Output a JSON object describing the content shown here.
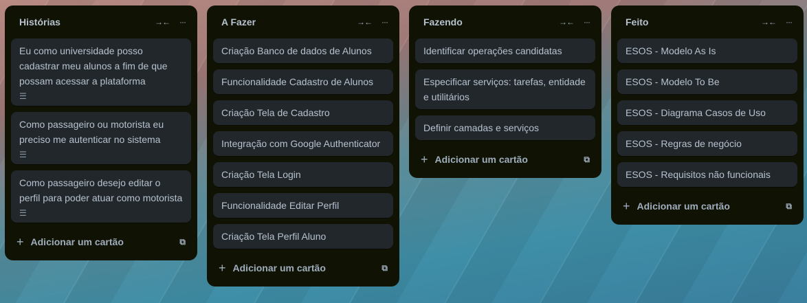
{
  "lists": [
    {
      "title": "Histórias",
      "cards": [
        {
          "text": "Eu como universidade posso cadastrar meu alunos a fim de que possam acessar a plataforma",
          "has_description": true
        },
        {
          "text": "Como passageiro ou motorista eu preciso me autenticar no sistema",
          "has_description": true
        },
        {
          "text": "Como passageiro desejo editar o perfil para poder atuar como motorista",
          "has_description": true
        }
      ]
    },
    {
      "title": "A Fazer",
      "cards": [
        {
          "text": "Criação Banco de dados de Alunos"
        },
        {
          "text": "Funcionalidade Cadastro de Alunos"
        },
        {
          "text": "Criação Tela de Cadastro"
        },
        {
          "text": "Integração com Google Authenticator"
        },
        {
          "text": "Criação Tela Login"
        },
        {
          "text": "Funcionalidade Editar Perfil"
        },
        {
          "text": "Criação Tela Perfil Aluno"
        }
      ]
    },
    {
      "title": "Fazendo",
      "cards": [
        {
          "text": "Identificar operações candidatas"
        },
        {
          "text": "Especificar serviços: tarefas, entidade e utilitários"
        },
        {
          "text": "Definir camadas e serviços"
        }
      ]
    },
    {
      "title": "Feito",
      "cards": [
        {
          "text": "ESOS - Modelo As Is"
        },
        {
          "text": "ESOS - Modelo To Be"
        },
        {
          "text": "ESOS - Diagrama Casos de Uso"
        },
        {
          "text": "ESOS - Regras de negócio"
        },
        {
          "text": "ESOS - Requisitos não funcionais"
        }
      ]
    }
  ],
  "add_card_label": "Adicionar um cartão",
  "icons": {
    "collapse": "collapse-arrows-icon",
    "menu": "more-horizontal-icon",
    "add": "plus-icon",
    "template": "card-template-icon",
    "description": "description-icon"
  }
}
